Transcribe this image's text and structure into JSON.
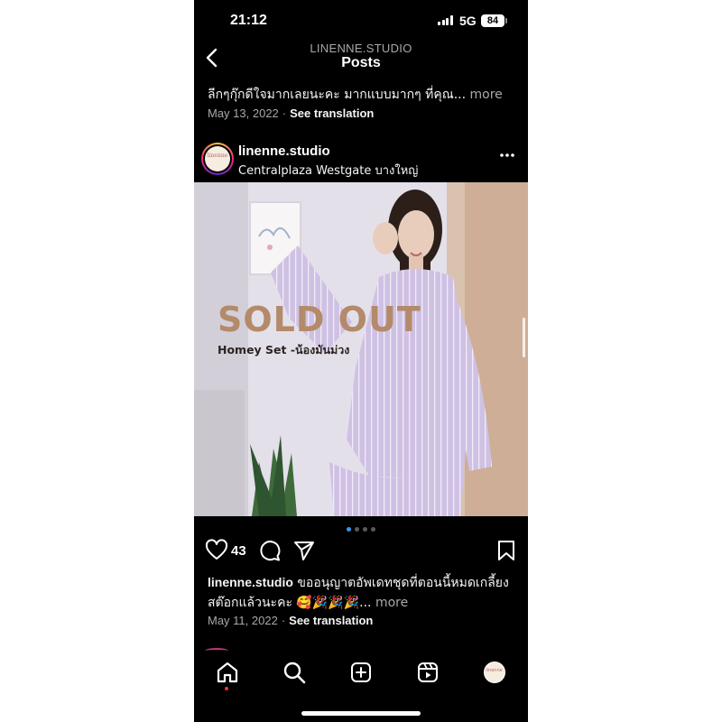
{
  "status": {
    "time": "21:12",
    "network": "5G",
    "battery": "84"
  },
  "nav": {
    "subtitle": "LINENNE.STUDIO",
    "title": "Posts"
  },
  "prev_post": {
    "caption": "ลีกๆกุ๊กดีใจมากเลยนะคะ มากแบบมากๆ  ที่คุณ...",
    "more": "more",
    "date": "May 13, 2022",
    "separator": "·",
    "translate": "See translation"
  },
  "post": {
    "username": "linenne.studio",
    "location": "Centralplaza Westgate บางใหญ่",
    "avatar_text": "linenne",
    "image": {
      "headline": "SOLD OUT",
      "subline": "Homey Set -น้องมันม่วง"
    },
    "carousel": {
      "count": 4,
      "active": 0
    },
    "likes": "43",
    "caption_user": "linenne.studio",
    "caption_text": "ขออนุญาตอัพเดทชุดที่ตอนนี้หมดเกลี้ยงสต๊อกแล้วนะคะ 🥰🎉🎉🎉...",
    "more": "more",
    "date": "May 11, 2022",
    "separator": "·",
    "translate": "See translation"
  },
  "icons": {
    "back": "chevron-left-icon",
    "options": "more-horizontal-icon",
    "like": "heart-icon",
    "comment": "comment-icon",
    "share": "send-icon",
    "save": "bookmark-icon",
    "tabs": [
      "home-icon",
      "search-icon",
      "create-icon",
      "reels-icon",
      "profile-avatar"
    ]
  },
  "colors": {
    "background": "#000000",
    "accent": "#3797f0",
    "notification": "#ff3040",
    "headline": "#b38a6a",
    "garment": "#cbbde0"
  }
}
